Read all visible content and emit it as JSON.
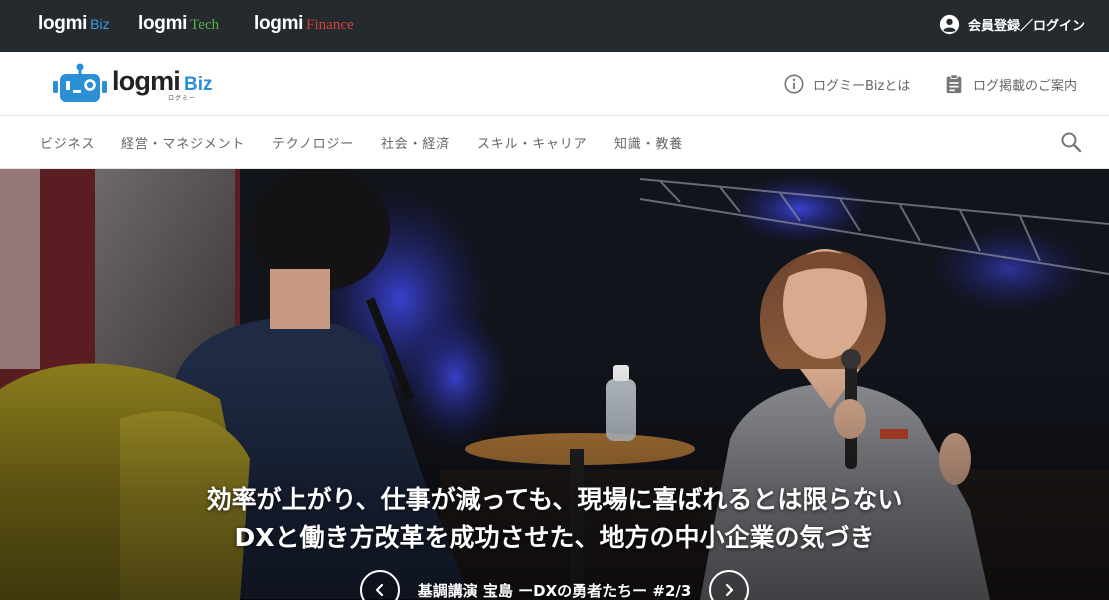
{
  "topbar": {
    "sites": [
      {
        "mark": "logmi",
        "sub": "Biz",
        "color": "#3a9be6"
      },
      {
        "mark": "logmi",
        "sub": "Tech",
        "color": "#58b44a"
      },
      {
        "mark": "logmi",
        "sub": "Finance",
        "color": "#d8403a"
      }
    ],
    "login_label": "会員登録／ログイン",
    "login_icon": "user-circle-icon"
  },
  "header": {
    "logo": {
      "word": "logmi",
      "sub": "Biz",
      "kana": "ログミー"
    },
    "links": [
      {
        "label": "ログミーBizとは",
        "icon": "info-icon"
      },
      {
        "label": "ログ掲載のご案内",
        "icon": "clipboard-icon"
      }
    ]
  },
  "nav": {
    "categories": [
      "ビジネス",
      "経営・マネジメント",
      "テクノロジー",
      "社会・経済",
      "スキル・キャリア",
      "知識・教養"
    ],
    "search_icon": "search-icon"
  },
  "hero": {
    "title_lines": [
      "効率が上がり、仕事が減っても、現場に喜ばれるとは限らない",
      "DXと働き方改革を成功させた、地方の中小企業の気づき"
    ],
    "subtitle": "基調講演 宝島 ーDXの勇者たちー #2/3",
    "prev_icon": "chevron-left-icon",
    "next_icon": "chevron-right-icon"
  },
  "colors": {
    "topbar_bg": "#252a2e",
    "brand_blue": "#2b8fd6"
  }
}
